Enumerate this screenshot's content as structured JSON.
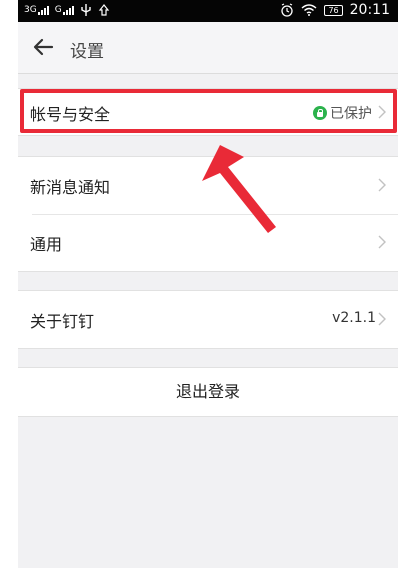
{
  "status_bar": {
    "network1": "3G",
    "network2": "G",
    "battery": "76",
    "time": "20:11"
  },
  "header": {
    "title": "设置"
  },
  "groups": [
    {
      "rows": [
        {
          "label": "帐号与安全",
          "status": "已保护",
          "status_icon": "lock-icon",
          "status_color": "#2bb24c"
        }
      ]
    },
    {
      "rows": [
        {
          "label": "新消息通知"
        },
        {
          "label": "通用"
        }
      ]
    },
    {
      "rows": [
        {
          "label": "关于钉钉",
          "value": "v2.1.1"
        }
      ]
    }
  ],
  "logout_label": "退出登录",
  "annotation_color": "#e92a37"
}
